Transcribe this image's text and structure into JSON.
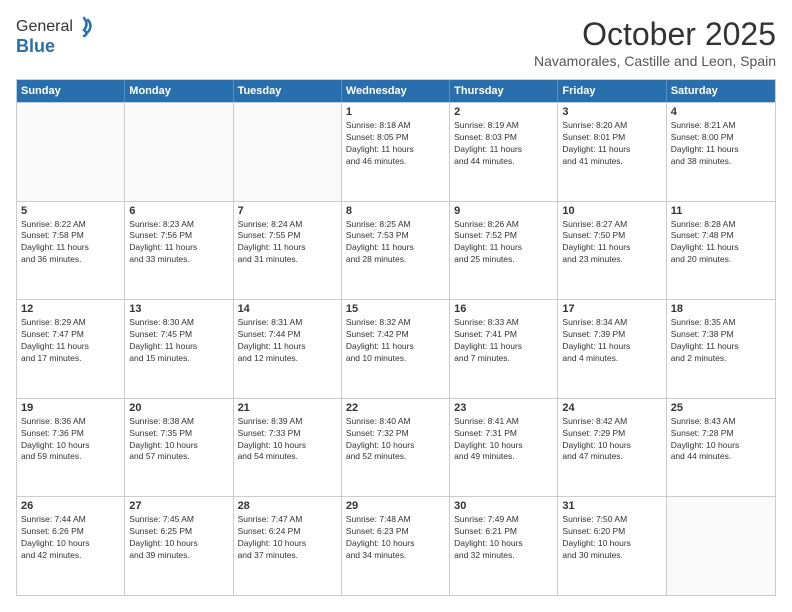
{
  "logo": {
    "general": "General",
    "blue": "Blue"
  },
  "header": {
    "month": "October 2025",
    "location": "Navamorales, Castille and Leon, Spain"
  },
  "days": [
    "Sunday",
    "Monday",
    "Tuesday",
    "Wednesday",
    "Thursday",
    "Friday",
    "Saturday"
  ],
  "weeks": [
    [
      {
        "date": "",
        "info": ""
      },
      {
        "date": "",
        "info": ""
      },
      {
        "date": "",
        "info": ""
      },
      {
        "date": "1",
        "info": "Sunrise: 8:18 AM\nSunset: 8:05 PM\nDaylight: 11 hours\nand 46 minutes."
      },
      {
        "date": "2",
        "info": "Sunrise: 8:19 AM\nSunset: 8:03 PM\nDaylight: 11 hours\nand 44 minutes."
      },
      {
        "date": "3",
        "info": "Sunrise: 8:20 AM\nSunset: 8:01 PM\nDaylight: 11 hours\nand 41 minutes."
      },
      {
        "date": "4",
        "info": "Sunrise: 8:21 AM\nSunset: 8:00 PM\nDaylight: 11 hours\nand 38 minutes."
      }
    ],
    [
      {
        "date": "5",
        "info": "Sunrise: 8:22 AM\nSunset: 7:58 PM\nDaylight: 11 hours\nand 36 minutes."
      },
      {
        "date": "6",
        "info": "Sunrise: 8:23 AM\nSunset: 7:56 PM\nDaylight: 11 hours\nand 33 minutes."
      },
      {
        "date": "7",
        "info": "Sunrise: 8:24 AM\nSunset: 7:55 PM\nDaylight: 11 hours\nand 31 minutes."
      },
      {
        "date": "8",
        "info": "Sunrise: 8:25 AM\nSunset: 7:53 PM\nDaylight: 11 hours\nand 28 minutes."
      },
      {
        "date": "9",
        "info": "Sunrise: 8:26 AM\nSunset: 7:52 PM\nDaylight: 11 hours\nand 25 minutes."
      },
      {
        "date": "10",
        "info": "Sunrise: 8:27 AM\nSunset: 7:50 PM\nDaylight: 11 hours\nand 23 minutes."
      },
      {
        "date": "11",
        "info": "Sunrise: 8:28 AM\nSunset: 7:48 PM\nDaylight: 11 hours\nand 20 minutes."
      }
    ],
    [
      {
        "date": "12",
        "info": "Sunrise: 8:29 AM\nSunset: 7:47 PM\nDaylight: 11 hours\nand 17 minutes."
      },
      {
        "date": "13",
        "info": "Sunrise: 8:30 AM\nSunset: 7:45 PM\nDaylight: 11 hours\nand 15 minutes."
      },
      {
        "date": "14",
        "info": "Sunrise: 8:31 AM\nSunset: 7:44 PM\nDaylight: 11 hours\nand 12 minutes."
      },
      {
        "date": "15",
        "info": "Sunrise: 8:32 AM\nSunset: 7:42 PM\nDaylight: 11 hours\nand 10 minutes."
      },
      {
        "date": "16",
        "info": "Sunrise: 8:33 AM\nSunset: 7:41 PM\nDaylight: 11 hours\nand 7 minutes."
      },
      {
        "date": "17",
        "info": "Sunrise: 8:34 AM\nSunset: 7:39 PM\nDaylight: 11 hours\nand 4 minutes."
      },
      {
        "date": "18",
        "info": "Sunrise: 8:35 AM\nSunset: 7:38 PM\nDaylight: 11 hours\nand 2 minutes."
      }
    ],
    [
      {
        "date": "19",
        "info": "Sunrise: 8:36 AM\nSunset: 7:36 PM\nDaylight: 10 hours\nand 59 minutes."
      },
      {
        "date": "20",
        "info": "Sunrise: 8:38 AM\nSunset: 7:35 PM\nDaylight: 10 hours\nand 57 minutes."
      },
      {
        "date": "21",
        "info": "Sunrise: 8:39 AM\nSunset: 7:33 PM\nDaylight: 10 hours\nand 54 minutes."
      },
      {
        "date": "22",
        "info": "Sunrise: 8:40 AM\nSunset: 7:32 PM\nDaylight: 10 hours\nand 52 minutes."
      },
      {
        "date": "23",
        "info": "Sunrise: 8:41 AM\nSunset: 7:31 PM\nDaylight: 10 hours\nand 49 minutes."
      },
      {
        "date": "24",
        "info": "Sunrise: 8:42 AM\nSunset: 7:29 PM\nDaylight: 10 hours\nand 47 minutes."
      },
      {
        "date": "25",
        "info": "Sunrise: 8:43 AM\nSunset: 7:28 PM\nDaylight: 10 hours\nand 44 minutes."
      }
    ],
    [
      {
        "date": "26",
        "info": "Sunrise: 7:44 AM\nSunset: 6:26 PM\nDaylight: 10 hours\nand 42 minutes."
      },
      {
        "date": "27",
        "info": "Sunrise: 7:45 AM\nSunset: 6:25 PM\nDaylight: 10 hours\nand 39 minutes."
      },
      {
        "date": "28",
        "info": "Sunrise: 7:47 AM\nSunset: 6:24 PM\nDaylight: 10 hours\nand 37 minutes."
      },
      {
        "date": "29",
        "info": "Sunrise: 7:48 AM\nSunset: 6:23 PM\nDaylight: 10 hours\nand 34 minutes."
      },
      {
        "date": "30",
        "info": "Sunrise: 7:49 AM\nSunset: 6:21 PM\nDaylight: 10 hours\nand 32 minutes."
      },
      {
        "date": "31",
        "info": "Sunrise: 7:50 AM\nSunset: 6:20 PM\nDaylight: 10 hours\nand 30 minutes."
      },
      {
        "date": "",
        "info": ""
      }
    ]
  ]
}
